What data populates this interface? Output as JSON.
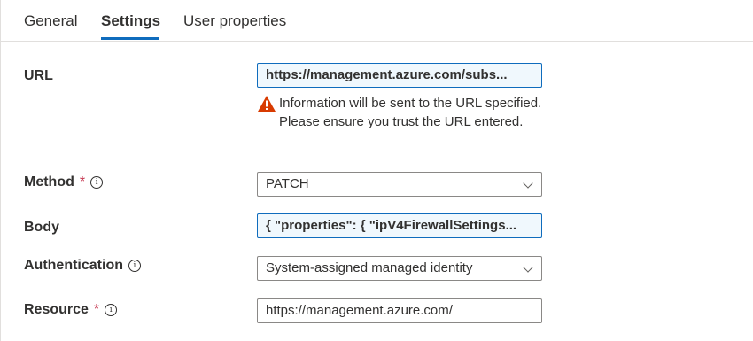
{
  "tabs": {
    "general": "General",
    "settings": "Settings",
    "user_properties": "User properties"
  },
  "form": {
    "url": {
      "label": "URL",
      "value": "https://management.azure.com/subs...",
      "warning": "Information will be sent to the URL specified. Please ensure you trust the URL entered."
    },
    "method": {
      "label": "Method",
      "required_marker": "*",
      "value": "PATCH"
    },
    "body": {
      "label": "Body",
      "value": "{ \"properties\": { \"ipV4FirewallSettings..."
    },
    "authentication": {
      "label": "Authentication",
      "value": "System-assigned managed identity"
    },
    "resource": {
      "label": "Resource",
      "required_marker": "*",
      "value": "https://management.azure.com/"
    }
  },
  "colors": {
    "accent": "#0f6cbd",
    "required": "#c4314b",
    "warning": "#d83b01",
    "readonly_bg": "#f0f8fd"
  },
  "icons": {
    "info": "info-icon",
    "warning": "warning-icon",
    "dropdown": "chevron-down-icon"
  }
}
